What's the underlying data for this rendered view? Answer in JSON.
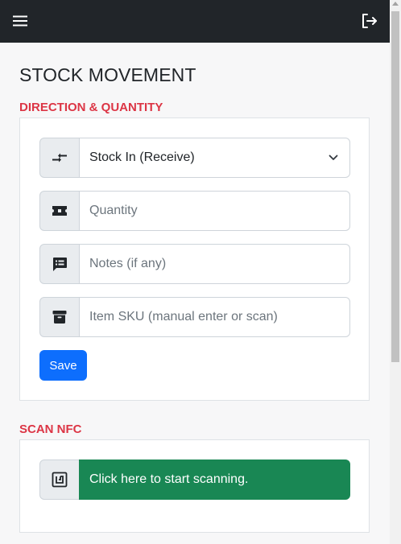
{
  "navbar": {
    "menu_icon": "hamburger-menu-icon",
    "logout_icon": "logout-icon"
  },
  "page": {
    "title": "STOCK MOVEMENT"
  },
  "direction_section": {
    "title": "DIRECTION & QUANTITY",
    "direction_select": {
      "icon": "arrows-exchange-icon",
      "value": "Stock In (Receive)"
    },
    "quantity": {
      "icon": "ticket-icon",
      "placeholder": "Quantity",
      "value": ""
    },
    "notes": {
      "icon": "comment-lines-icon",
      "placeholder": "Notes (if any)",
      "value": ""
    },
    "sku": {
      "icon": "archive-box-icon",
      "placeholder": "Item SKU (manual enter or scan)",
      "value": ""
    },
    "save_label": "Save"
  },
  "scan_section": {
    "title": "SCAN NFC",
    "icon": "nfc-icon",
    "button_label": "Click here to start scanning."
  },
  "colors": {
    "navbar": "#212529",
    "section_title": "#dc3545",
    "primary": "#0d6efd",
    "success": "#198754"
  }
}
